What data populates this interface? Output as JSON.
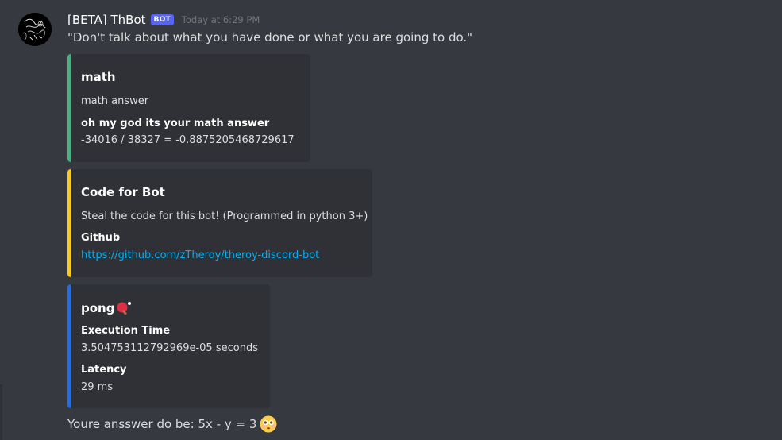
{
  "message": {
    "username": "[BETA] ThBot",
    "bot_tag": "BOT",
    "timestamp": "Today at 6:29 PM",
    "text": "\"Don't talk about what you have done or what you are going to do.\""
  },
  "embeds": [
    {
      "color": "#43b581",
      "title": "math",
      "description": "math answer",
      "fields": [
        {
          "name": "oh my god its your math answer",
          "value": "-34016 / 38327 = -0.8875205468729617"
        }
      ]
    },
    {
      "color": "#faca17",
      "title": "Code for Bot",
      "description": "Steal the code for this bot! (Programmed in python 3+)",
      "fields": [
        {
          "name": "Github",
          "value": "https://github.com/zTheroy/theroy-discord-bot"
        }
      ]
    },
    {
      "color": "#1e6ef0",
      "title": "pong",
      "title_emoji": "ping-pong-icon",
      "fields": [
        {
          "name": "Execution Time",
          "value": "3.504753112792969e-05 seconds"
        },
        {
          "name": "Latency",
          "value": "29 ms"
        }
      ]
    }
  ],
  "final_message": {
    "text": "Youre ansswer do be: 5x - y = 3",
    "emoji": "flushed-face-icon"
  },
  "colors": {
    "background": "#36393f",
    "embed_background": "#2f3136",
    "bot_tag": "#5865f2",
    "link": "#00aff4"
  }
}
